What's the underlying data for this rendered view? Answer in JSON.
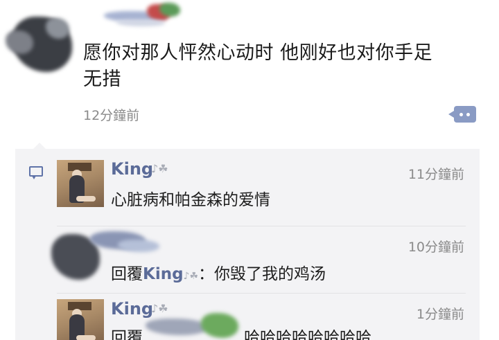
{
  "post": {
    "text_line1": "愿你对那人怦然心动时 他刚好也对你手足",
    "text_line2": "无措",
    "time": "12分鐘前",
    "comment_icon": "comment-bubble-icon"
  },
  "comments": [
    {
      "name": "King",
      "time": "11分鐘前",
      "text": "心脏病和帕金森的爱情"
    },
    {
      "reply_prefix": "回覆",
      "reply_to": "King",
      "reply_suffix": "：你毁了我的鸡汤",
      "time": "10分鐘前"
    },
    {
      "name": "King",
      "time": "1分鐘前",
      "reply_prefix": "回覆",
      "text": "哈哈哈哈哈哈哈哈"
    }
  ],
  "colors": {
    "name_blue": "#5b6b98",
    "comment_bg": "#f3f3f5",
    "time_gray": "#8a8a8a"
  }
}
